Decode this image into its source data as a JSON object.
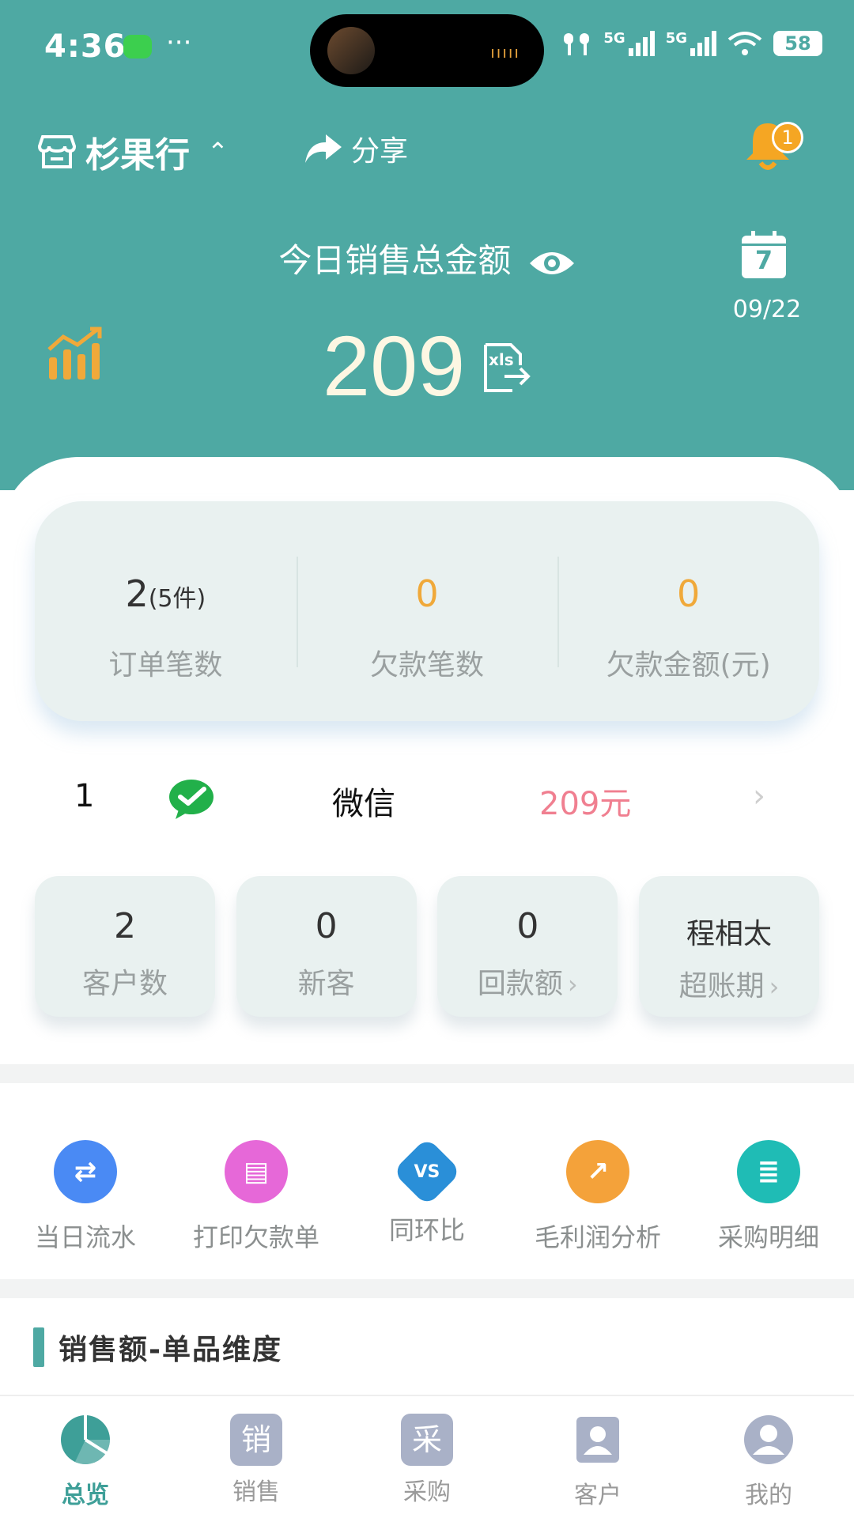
{
  "status_bar": {
    "time": "4:36",
    "dots": "···",
    "network1": "5G",
    "network2": "5G",
    "battery": "58",
    "island_wave": "ııııı"
  },
  "header": {
    "store_name": "杉果行",
    "store_chevron": "⌃",
    "share_label": "分享",
    "notification_count": "1",
    "sales_title": "今日销售总金额",
    "total_amount": "209",
    "calendar_day": "7",
    "date": "09/22",
    "xls_label": "xls"
  },
  "stats": [
    {
      "value": "2",
      "suffix": "(5件)",
      "label": "订单笔数",
      "accent": "#333333"
    },
    {
      "value": "0",
      "suffix": "",
      "label": "欠款笔数",
      "accent": "#f0a93a"
    },
    {
      "value": "0",
      "suffix": "",
      "label": "欠款金额(元)",
      "accent": "#f0a93a"
    }
  ],
  "payment": {
    "index": "1",
    "method": "微信",
    "amount": "209元",
    "arrow": "›"
  },
  "tiles": [
    {
      "value": "2",
      "label": "客户数",
      "arrow": ""
    },
    {
      "value": "0",
      "label": "新客",
      "arrow": ""
    },
    {
      "value": "0",
      "label": "回款额",
      "arrow": "›"
    },
    {
      "value": "程相太",
      "label": "超账期",
      "arrow": "›"
    }
  ],
  "quick_actions": [
    {
      "label": "当日流水",
      "icon": "transfer-icon",
      "color": "#4a8af4",
      "glyph": "⇄"
    },
    {
      "label": "打印欠款单",
      "icon": "printer-icon",
      "color": "#e668d8",
      "glyph": "▤"
    },
    {
      "label": "同环比",
      "icon": "vs-icon",
      "color": "#2a8fd8",
      "glyph": "VS"
    },
    {
      "label": "毛利润分析",
      "icon": "profit-chart-icon",
      "color": "#f4a23a",
      "glyph": "↗"
    },
    {
      "label": "采购明细",
      "icon": "purchase-list-icon",
      "color": "#1fbcb5",
      "glyph": "≣"
    }
  ],
  "section_title": "销售额-单品维度",
  "tabs": [
    {
      "label": "总览",
      "glyph": "",
      "icon": "overview-pie-icon",
      "active": true
    },
    {
      "label": "销售",
      "glyph": "销",
      "icon": "sales-icon",
      "active": false
    },
    {
      "label": "采购",
      "glyph": "采",
      "icon": "purchase-icon",
      "active": false
    },
    {
      "label": "客户",
      "glyph": "",
      "icon": "customer-icon",
      "active": false
    },
    {
      "label": "我的",
      "glyph": "",
      "icon": "profile-icon",
      "active": false
    }
  ],
  "colors": {
    "brand": "#4ea9a3",
    "accent_orange": "#f0a93a",
    "amount_pink": "#f07f90"
  }
}
